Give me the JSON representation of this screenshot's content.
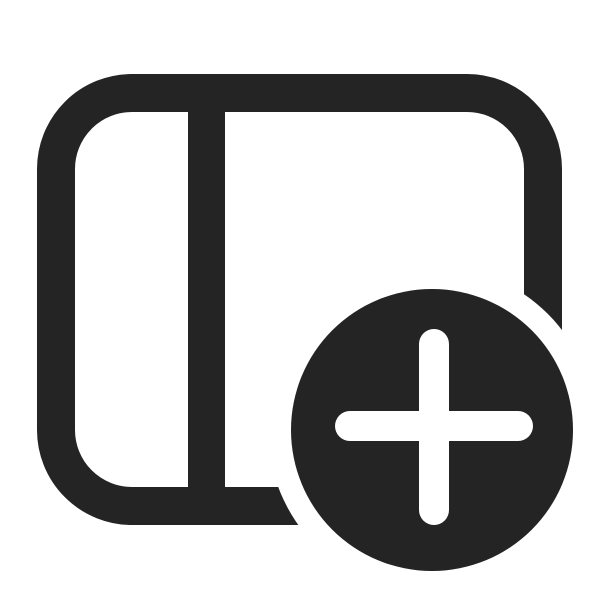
{
  "icon": {
    "name": "panel-left-add-icon",
    "color": "#242424",
    "background": "#ffffff",
    "parts": [
      "rounded-window-frame",
      "left-sidebar-divider",
      "add-badge",
      "plus-glyph"
    ]
  }
}
